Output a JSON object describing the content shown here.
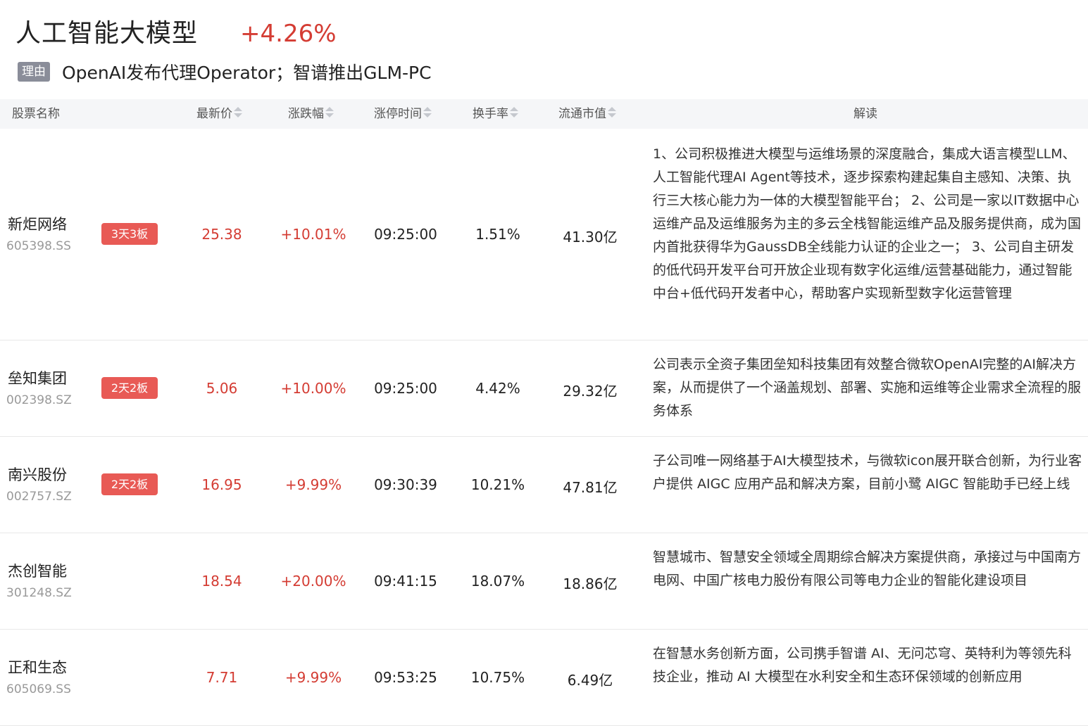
{
  "header": {
    "title": "人工智能大模型",
    "change": "+4.26%",
    "reason_label": "理由",
    "reason_text": "OpenAI发布代理Operator；智谱推出GLM-PC"
  },
  "columns": {
    "name": "股票名称",
    "price": "最新价",
    "pct": "涨跌幅",
    "limit_time": "涨停时间",
    "turnover": "换手率",
    "market_cap": "流通市值",
    "desc": "解读"
  },
  "rows": [
    {
      "name": "新炬网络",
      "code": "605398.SS",
      "tag": "3天3板",
      "price": "25.38",
      "pct": "+10.01%",
      "limit_time": "09:25:00",
      "turnover": "1.51%",
      "market_cap": "41.30亿",
      "desc": "1、公司积极推进大模型与运维场景的深度融合，集成大语言模型LLM、人工智能代理AI Agent等技术，逐步探索构建起集自主感知、决策、执行三大核心能力为一体的大模型智能平台； 2、公司是一家以IT数据中心运维产品及运维服务为主的多云全栈智能运维产品及服务提供商，成为国内首批获得华为GaussDB全线能力认证的企业之一； 3、公司自主研发的低代码开发平台可开放企业现有数字化运维/运营基础能力，通过智能中台+低代码开发者中心，帮助客户实现新型数字化运营管理"
    },
    {
      "name": "垒知集团",
      "code": "002398.SZ",
      "tag": "2天2板",
      "price": "5.06",
      "pct": "+10.00%",
      "limit_time": "09:25:00",
      "turnover": "4.42%",
      "market_cap": "29.32亿",
      "desc": "公司表示全资子集团垒知科技集团有效整合微软OpenAI完整的AI解决方案，从而提供了一个涵盖规划、部署、实施和运维等企业需求全流程的服务体系"
    },
    {
      "name": "南兴股份",
      "code": "002757.SZ",
      "tag": "2天2板",
      "price": "16.95",
      "pct": "+9.99%",
      "limit_time": "09:30:39",
      "turnover": "10.21%",
      "market_cap": "47.81亿",
      "desc": "子公司唯一网络基于AI大模型技术，与微软icon展开联合创新，为行业客户提供 AIGC 应用产品和解决方案，目前小鹭 AIGC 智能助手已经上线"
    },
    {
      "name": "杰创智能",
      "code": "301248.SZ",
      "tag": "",
      "price": "18.54",
      "pct": "+20.00%",
      "limit_time": "09:41:15",
      "turnover": "18.07%",
      "market_cap": "18.86亿",
      "desc": "智慧城市、智慧安全领域全周期综合解决方案提供商，承接过与中国南方电网、中国广核电力股份有限公司等电力企业的智能化建设项目"
    },
    {
      "name": "正和生态",
      "code": "605069.SS",
      "tag": "",
      "price": "7.71",
      "pct": "+9.99%",
      "limit_time": "09:53:25",
      "turnover": "10.75%",
      "market_cap": "6.49亿",
      "desc": "在智慧水务创新方面，公司携手智谱 AI、无问芯穹、英特利为等领先科技企业，推动 AI 大模型在水利安全和生态环保领域的创新应用"
    }
  ],
  "colors": {
    "up": "#d43c33",
    "tag": "#e85a55",
    "badge": "#8a8d99"
  }
}
